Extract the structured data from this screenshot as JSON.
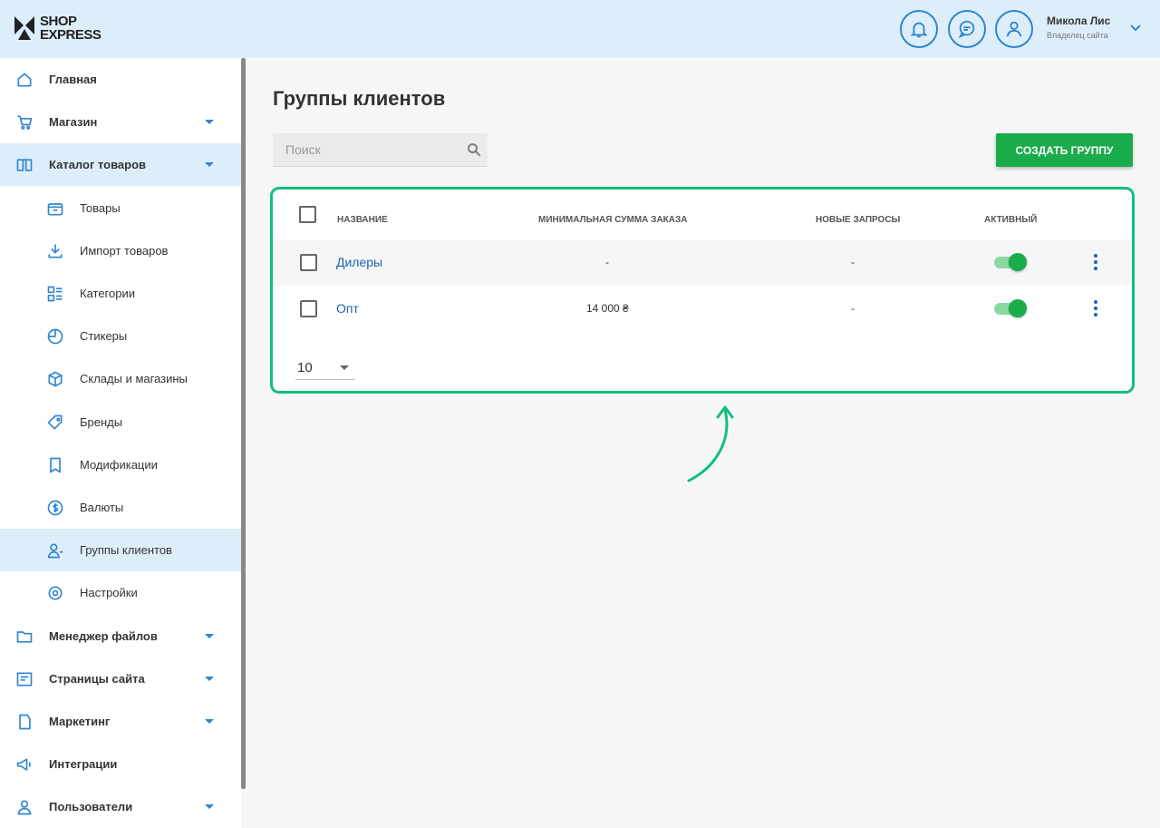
{
  "header": {
    "logo_line1": "SHOP",
    "logo_line2": "EXPRESS",
    "user_name": "Микола Лис",
    "user_role": "Владелец сайта",
    "buttons": [
      "bell-icon",
      "chat-icon",
      "user-icon"
    ]
  },
  "sidebar": {
    "items": [
      {
        "label": "Главная",
        "icon": "home-icon",
        "level": "top",
        "caret": false,
        "active": false
      },
      {
        "label": "Магазин",
        "icon": "cart-icon",
        "level": "top",
        "caret": true,
        "active": false
      },
      {
        "label": "Каталог товаров",
        "icon": "book-icon",
        "level": "top",
        "caret": true,
        "active": true
      },
      {
        "label": "Товары",
        "icon": "box-icon",
        "level": "sub",
        "caret": false,
        "active": false
      },
      {
        "label": "Импорт товаров",
        "icon": "download-icon",
        "level": "sub",
        "caret": false,
        "active": false
      },
      {
        "label": "Категории",
        "icon": "categories-icon",
        "level": "sub",
        "caret": false,
        "active": false
      },
      {
        "label": "Стикеры",
        "icon": "sticker-icon",
        "level": "sub",
        "caret": false,
        "active": false
      },
      {
        "label": "Склады и магазины",
        "icon": "cube-icon",
        "level": "sub",
        "caret": false,
        "active": false
      },
      {
        "label": "Бренды",
        "icon": "tag-icon",
        "level": "sub",
        "caret": false,
        "active": false
      },
      {
        "label": "Модификации",
        "icon": "bookmark-icon",
        "level": "sub",
        "caret": false,
        "active": false
      },
      {
        "label": "Валюты",
        "icon": "dollar-icon",
        "level": "sub",
        "caret": false,
        "active": false
      },
      {
        "label": "Группы клиентов",
        "icon": "user-group-icon",
        "level": "sub",
        "caret": false,
        "active": true
      },
      {
        "label": "Настройки",
        "icon": "gear-icon",
        "level": "sub",
        "caret": false,
        "active": false
      },
      {
        "label": "Менеджер файлов",
        "icon": "folder-icon",
        "level": "top",
        "caret": true,
        "active": false
      },
      {
        "label": "Страницы сайта",
        "icon": "page-icon",
        "level": "top",
        "caret": true,
        "active": false
      },
      {
        "label": "Маркетинг",
        "icon": "marketing-icon",
        "level": "top",
        "caret": true,
        "active": false
      },
      {
        "label": "Интеграции",
        "icon": "megaphone-icon",
        "level": "top",
        "caret": false,
        "active": false
      },
      {
        "label": "Пользователи",
        "icon": "users-icon",
        "level": "top",
        "caret": true,
        "active": false
      }
    ]
  },
  "main": {
    "title": "Группы клиентов",
    "search_placeholder": "Поиск",
    "create_button": "Создать группу",
    "table": {
      "columns": [
        "Название",
        "Минимальная сумма заказа",
        "Новые запросы",
        "Активный"
      ],
      "rows": [
        {
          "name": "Дилеры",
          "min_order": "-",
          "new_requests": "-",
          "active": true
        },
        {
          "name": "Опт",
          "min_order": "14 000 ₴",
          "new_requests": "-",
          "active": true
        }
      ],
      "per_page": "10"
    }
  },
  "colors": {
    "accent": "#2f86cf",
    "brand_green": "#1aab4b",
    "highlight_border": "#12c07a",
    "header_bg": "#ddeefb"
  }
}
